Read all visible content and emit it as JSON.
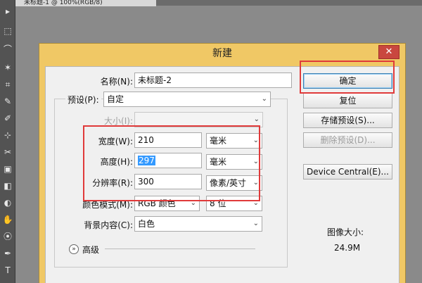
{
  "app": {
    "doc_tab": "未标题-1 @ 100%(RGB/8)",
    "tools": [
      "▸",
      "⬚",
      "⌒",
      "✶",
      "⌗",
      "✎",
      "✐",
      "⊹",
      "✂",
      "▣",
      "◧",
      "◐",
      "✋",
      "⦿",
      "✒",
      "T"
    ]
  },
  "dialog": {
    "title": "新建",
    "close_glyph": "✕",
    "name_label": "名称(N):",
    "name_value": "未标题-2",
    "preset_label": "预设(P):",
    "preset_value": "自定",
    "size_label": "大小(I):",
    "size_value": "",
    "width_label": "宽度(W):",
    "width_value": "210",
    "width_unit": "毫米",
    "height_label": "高度(H):",
    "height_value": "297",
    "height_unit": "毫米",
    "resolution_label": "分辨率(R):",
    "resolution_value": "300",
    "resolution_unit": "像素/英寸",
    "color_mode_label": "颜色模式(M):",
    "color_mode_value": "RGB 颜色",
    "bit_depth_value": "8 位",
    "bg_label": "背景内容(C):",
    "bg_value": "白色",
    "advanced_label": "高级",
    "advanced_icon": "»",
    "image_size_label": "图像大小:",
    "image_size_value": "24.9M",
    "buttons": {
      "ok": "确定",
      "reset": "复位",
      "save_preset": "存储预设(S)...",
      "delete_preset": "删除预设(D)...",
      "device_central": "Device Central(E)..."
    },
    "dropdown_arrow": "⌄"
  }
}
